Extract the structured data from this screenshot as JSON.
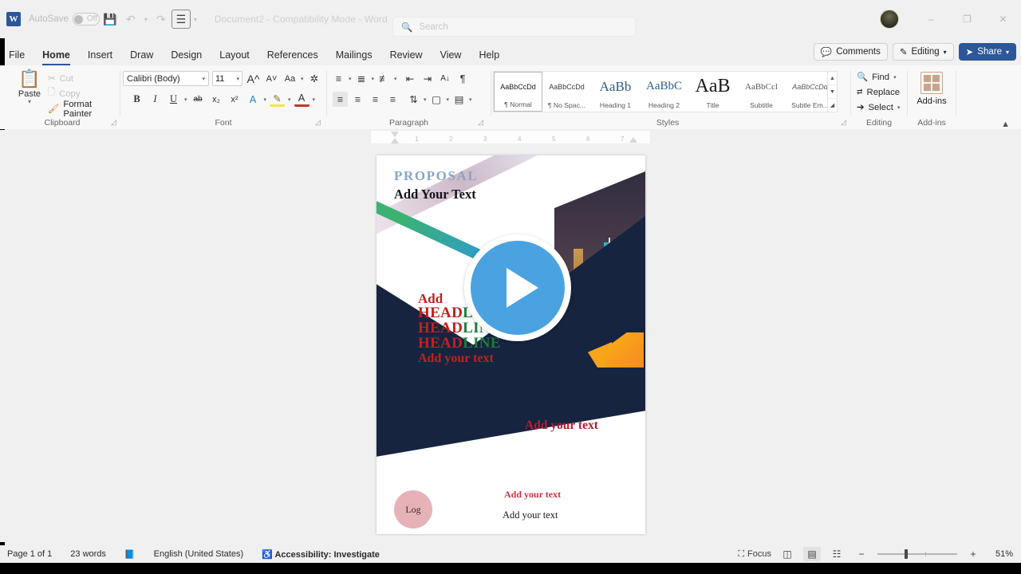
{
  "titlebar": {
    "logo": "W",
    "autosave_label": "AutoSave",
    "autosave_state": "Off",
    "save_icon": "save-icon",
    "undo_icon": "undo-icon",
    "redo_icon": "redo-icon",
    "quickprint_icon": "list-icon",
    "customize_icon": "chevron-down-icon",
    "document_title": "Document2  -  Compatibility Mode  -  Word",
    "search_placeholder": "Search",
    "minimize": "–",
    "restore": "❐",
    "close": "✕"
  },
  "tabs": [
    {
      "label": "File",
      "active": false
    },
    {
      "label": "Home",
      "active": true
    },
    {
      "label": "Insert",
      "active": false
    },
    {
      "label": "Draw",
      "active": false
    },
    {
      "label": "Design",
      "active": false
    },
    {
      "label": "Layout",
      "active": false
    },
    {
      "label": "References",
      "active": false
    },
    {
      "label": "Mailings",
      "active": false
    },
    {
      "label": "Review",
      "active": false
    },
    {
      "label": "View",
      "active": false
    },
    {
      "label": "Help",
      "active": false
    }
  ],
  "tabright": {
    "comments": "Comments",
    "editing": "Editing",
    "share": "Share"
  },
  "ribbon": {
    "clipboard": {
      "group_label": "Clipboard",
      "paste": "Paste",
      "cut": "Cut",
      "copy": "Copy",
      "format_painter": "Format Painter"
    },
    "font": {
      "group_label": "Font",
      "font_name": "Calibri (Body)",
      "font_size": "11",
      "grow": "A",
      "shrink": "A",
      "change_case": "Aa",
      "clear_formatting": "clear-formatting-icon",
      "bold": "B",
      "italic": "I",
      "underline": "U",
      "strikethrough": "ab",
      "subscript": "x",
      "superscript": "x",
      "text_effects": "A",
      "highlight": "highlight-icon",
      "font_color": "A"
    },
    "paragraph": {
      "group_label": "Paragraph",
      "bullets": "bullets-icon",
      "numbering": "numbering-icon",
      "multilevel": "multilevel-list-icon",
      "decrease_indent": "decrease-indent-icon",
      "increase_indent": "increase-indent-icon",
      "sort": "sort-icon",
      "show_marks": "¶",
      "align_left": "align-left-icon",
      "align_center": "align-center-icon",
      "align_right": "align-right-icon",
      "justify": "justify-icon",
      "line_spacing": "line-spacing-icon",
      "shading": "shading-icon",
      "borders": "borders-icon"
    },
    "styles": {
      "group_label": "Styles",
      "items": [
        {
          "preview": "AaBbCcDd",
          "name": "¶ Normal",
          "selected": true
        },
        {
          "preview": "AaBbCcDd",
          "name": "¶ No Spac...",
          "selected": false
        },
        {
          "preview": "AaBb",
          "name": "Heading 1",
          "selected": false
        },
        {
          "preview": "AaBbC",
          "name": "Heading 2",
          "selected": false
        },
        {
          "preview": "AaB",
          "name": "Title",
          "selected": false
        },
        {
          "preview": "AaBbCcl",
          "name": "Subtitle",
          "selected": false
        },
        {
          "preview": "AaBbCcDd",
          "name": "Subtle Em...",
          "selected": false
        }
      ]
    },
    "editing": {
      "group_label": "Editing",
      "find": "Find",
      "replace": "Replace",
      "select": "Select"
    },
    "addins": {
      "group_label": "Add-ins",
      "label": "Add-ins"
    },
    "collapse_icon": "chevron-up-icon"
  },
  "ruler": {
    "ticks": [
      "1",
      "2",
      "3",
      "4",
      "5",
      "6",
      "7"
    ],
    "tab_stop_marker": "L"
  },
  "document": {
    "title_small": "PROPOSAL",
    "title_main": "Add Your Text",
    "headline_first": "Add",
    "headline_lines": [
      {
        "red": "HEAD",
        "green": "LINE"
      },
      {
        "red": "HEAD",
        "green": "LINE"
      },
      {
        "red": "HEAD",
        "green": "LINE"
      }
    ],
    "headline_last": "Add your text",
    "mid_text": "Add your text",
    "footer_red": "Add your text",
    "footer_black": "Add your text",
    "logo_text": "Log",
    "play_button": "play-icon",
    "colors": {
      "navy": "#16243f",
      "red": "#c32020",
      "green": "#1f7a3d",
      "proposal_blue": "#8aa4c8",
      "logo_pink": "#e6b2b8",
      "play_blue": "#4aa3e0",
      "orange": "#f7a51d"
    }
  },
  "status": {
    "page": "Page 1 of 1",
    "words": "23 words",
    "proofing_icon": "proofing-icon",
    "language": "English (United States)",
    "accessibility": "Accessibility: Investigate",
    "focus": "Focus",
    "view_read": "read-mode-icon",
    "view_print": "print-layout-icon",
    "view_web": "web-layout-icon",
    "zoom_out": "−",
    "zoom_in": "+",
    "zoom_level": "51%"
  }
}
